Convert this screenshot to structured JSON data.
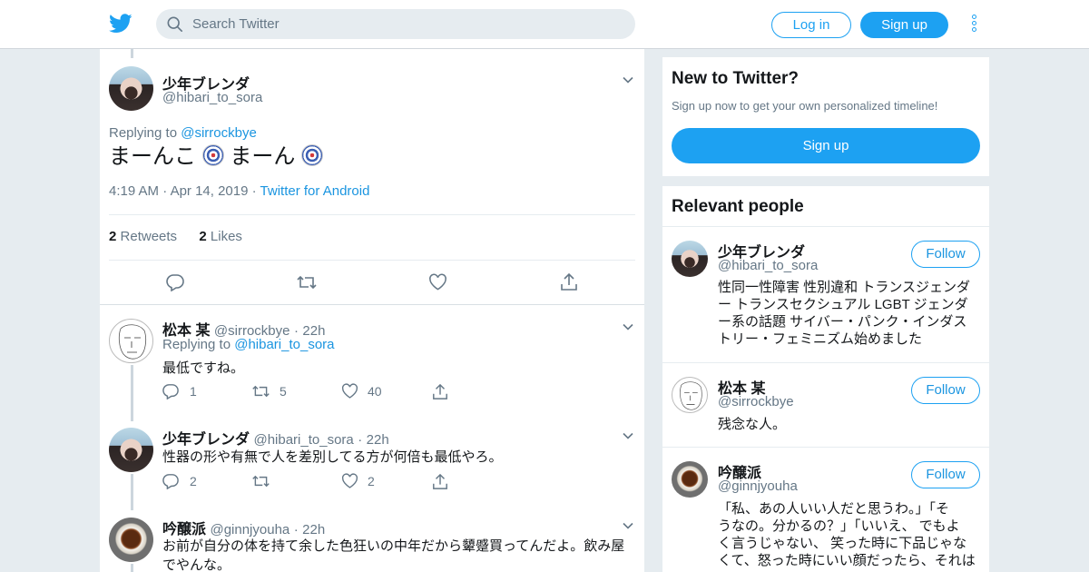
{
  "header": {
    "search_placeholder": "Search Twitter",
    "login_label": "Log in",
    "signup_label": "Sign up"
  },
  "tweet": {
    "name": "少年ブレンダ",
    "handle": "@hibari_to_sora",
    "replying_label": "Replying to",
    "replying_to": "@sirrockbye",
    "text_part1": "まーんこ",
    "text_part2": "まーん",
    "time": "4:19 AM",
    "date": "Apr 14, 2019",
    "source": "Twitter for Android",
    "retweets_count": "2",
    "retweets_label": "Retweets",
    "likes_count": "2",
    "likes_label": "Likes"
  },
  "replies": [
    {
      "name": "松本 某",
      "handle": "@sirrockbye",
      "time": "22h",
      "replying_label": "Replying to",
      "replying_to": "@hibari_to_sora",
      "text": "最低ですね。",
      "reply_count": "1",
      "retweet_count": "5",
      "like_count": "40"
    },
    {
      "name": "少年ブレンダ",
      "handle": "@hibari_to_sora",
      "time": "22h",
      "text": "性器の形や有無で人を差別してる方が何倍も最低やろ。",
      "reply_count": "2",
      "retweet_count": "",
      "like_count": "2"
    },
    {
      "name": "吟醸派",
      "handle": "@ginnjyouha",
      "time": "22h",
      "text_line1": "お前が自分の体を持て余した色狂いの中年だから顰蹙買ってんだよ。飲み屋",
      "text_line2": "でやんな。"
    }
  ],
  "sidebar": {
    "new_title": "New to Twitter?",
    "new_subtitle": "Sign up now to get your own personalized timeline!",
    "signup_label": "Sign up",
    "relevant_title": "Relevant people",
    "follow_label": "Follow",
    "people": [
      {
        "name": "少年ブレンダ",
        "handle": "@hibari_to_sora",
        "bio": [
          "性同一性障害 性別違和 トランスジェンダ",
          "ー トランスセクシュアル LGBT ジェンダ",
          "ー系の話題 サイバー・パンク・インダス",
          "トリー・フェミニズム始めました"
        ]
      },
      {
        "name": "松本 某",
        "handle": "@sirrockbye",
        "bio": [
          "残念な人。"
        ]
      },
      {
        "name": "吟醸派",
        "handle": "@ginnjyouha",
        "bio": [
          "「私、あの人いい人だと思うわ。」「そ",
          "うなの。分かるの？」「いいえ、 でもよ",
          "く言うじゃない、 笑った時に下品じゃな",
          "くて、怒った時にいい顔だったら、それは"
        ]
      }
    ]
  },
  "colors": {
    "accent": "#1da1f2",
    "link": "#1b95e0",
    "secondary_text": "#657786",
    "background": "#e6ecf0"
  }
}
